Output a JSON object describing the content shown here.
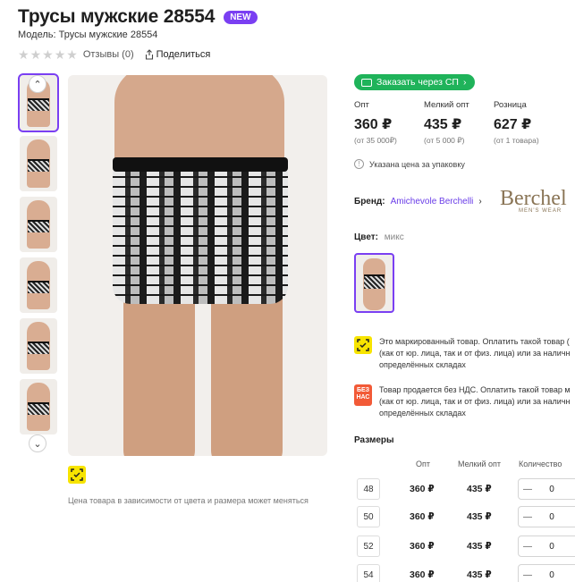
{
  "product": {
    "title": "Трусы мужские 28554",
    "badge": "NEW",
    "model": "Модель: Трусы мужские 28554",
    "reviews": "Отзывы (0)",
    "share": "Поделиться"
  },
  "image_note": "Цена товара в зависимости от цвета и размера может меняться",
  "order_button": "Заказать через СП",
  "prices": [
    {
      "label": "Опт",
      "value": "360 ₽",
      "sub": "(от 35 000₽)"
    },
    {
      "label": "Мелкий опт",
      "value": "435 ₽",
      "sub": "(от 5 000 ₽)"
    },
    {
      "label": "Розница",
      "value": "627 ₽",
      "sub": "(от 1 товара)"
    }
  ],
  "pack_note": "Указана цена за упаковку",
  "brand": {
    "label": "Бренд:",
    "name": "Amichevole Berchelli",
    "logo_text": "Berchel",
    "logo_sub": "MEN'S WEAR"
  },
  "color": {
    "label": "Цвет:",
    "value": "микс"
  },
  "notices": {
    "marked": [
      "Это маркированный товар. Оплатить такой товар (",
      "(как от юр. лица, так и от физ. лица) или за наличн",
      "определённых складах"
    ],
    "nds_icon": "БЕЗ НАС",
    "nds": [
      "Товар продается без НДС. Оплатить такой товар м",
      "(как от юр. лица, так и от физ. лица) или за наличн",
      "определённых складах"
    ]
  },
  "sizes": {
    "title": "Размеры",
    "headers": {
      "opt": "Опт",
      "small_opt": "Мелкий опт",
      "qty": "Количество"
    },
    "rows": [
      {
        "size": "48",
        "opt": "360 ₽",
        "small": "435 ₽",
        "qty": "0"
      },
      {
        "size": "50",
        "opt": "360 ₽",
        "small": "435 ₽",
        "qty": "0"
      },
      {
        "size": "52",
        "opt": "360 ₽",
        "small": "435 ₽",
        "qty": "0"
      },
      {
        "size": "54",
        "opt": "360 ₽",
        "small": "435 ₽",
        "qty": "0"
      }
    ]
  },
  "icons": {
    "star": "star-icon",
    "share": "share-icon",
    "scroll_up": "chevron-up-icon",
    "scroll_down": "chevron-down-icon",
    "info": "info-icon",
    "chevron": "chevron-right-icon"
  },
  "colors": {
    "accent": "#7a3ff2",
    "green": "#1fb35a",
    "mark_yellow": "#f7e400",
    "nds_red": "#f25a37"
  }
}
